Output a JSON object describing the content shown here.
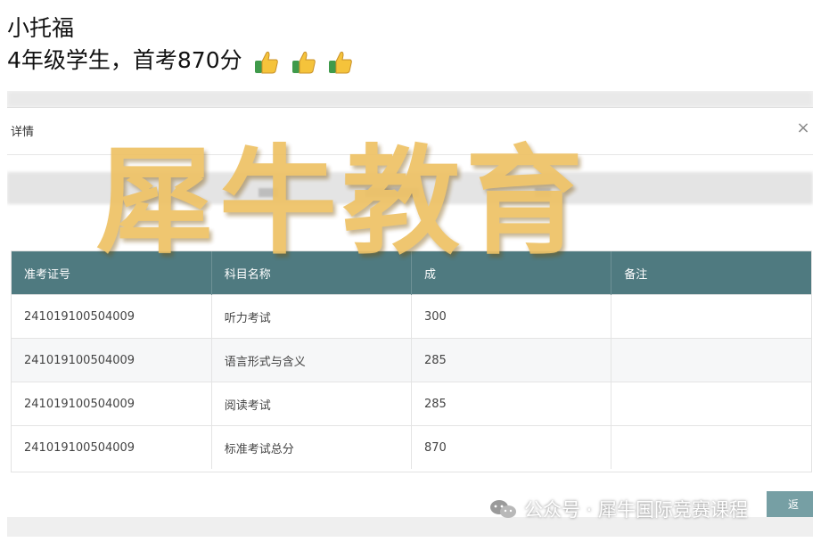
{
  "caption": {
    "name": "小托福",
    "line2": "4年级学生，首考870分",
    "emoji_icon": "thumbs-up-icon"
  },
  "modal": {
    "title": "详情",
    "close_symbol": "×"
  },
  "table": {
    "headers": [
      "准考证号",
      "科目名称",
      "成",
      "备注"
    ],
    "rows": [
      [
        "241019100504009",
        "听力考试",
        "300",
        ""
      ],
      [
        "241019100504009",
        "语言形式与含义",
        "285",
        ""
      ],
      [
        "241019100504009",
        "阅读考试",
        "285",
        ""
      ],
      [
        "241019100504009",
        "标准考试总分",
        "870",
        ""
      ]
    ]
  },
  "footer": {
    "button_label": "返"
  },
  "watermark": {
    "text": "犀牛教育",
    "account": "公众号 · 犀牛国际竞赛课程"
  },
  "colors": {
    "table_header": "#4f7a80",
    "watermark_gold": "#eec266",
    "thumb_yellow": "#f5c33b",
    "cuff_green": "#3f9a4b"
  }
}
